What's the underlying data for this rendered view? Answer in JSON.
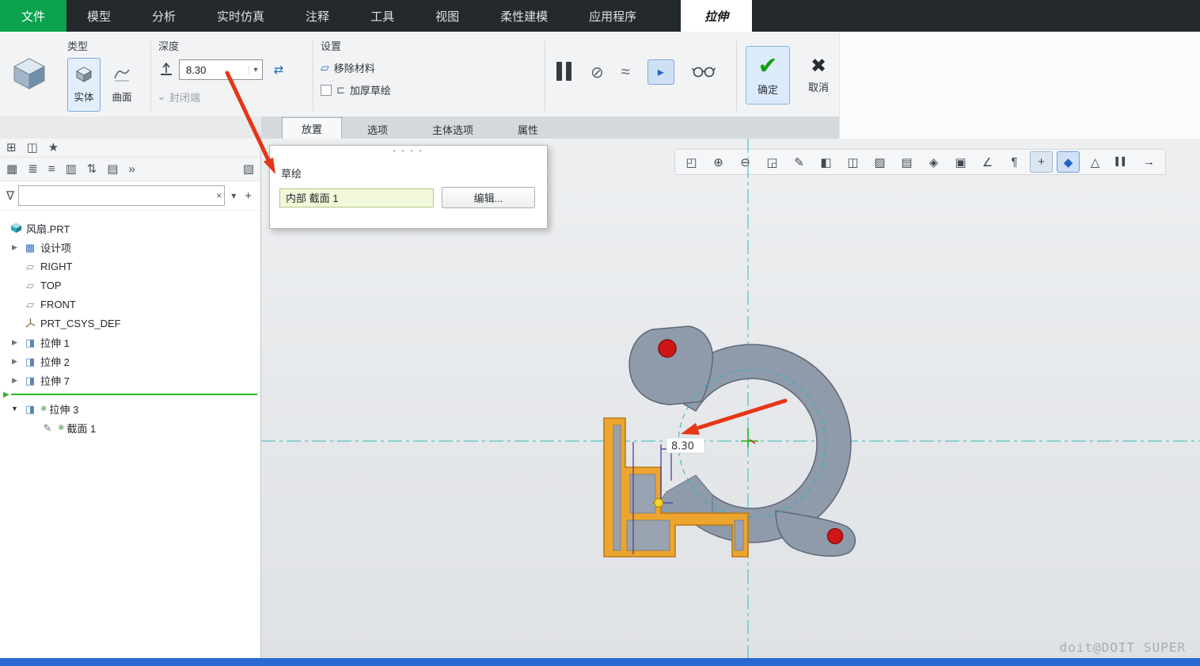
{
  "menubar": {
    "file_label": "文件",
    "items": [
      "模型",
      "分析",
      "实时仿真",
      "注释",
      "工具",
      "视图",
      "柔性建模",
      "应用程序"
    ],
    "feature_tab": "拉伸"
  },
  "ribbon": {
    "type_group": {
      "label": "类型",
      "solid_label": "实体",
      "surface_label": "曲面"
    },
    "depth_group": {
      "label": "深度",
      "depth_value": "8.30",
      "caret": "▾",
      "flip_glyph": "⇄",
      "capped_label": "封闭端",
      "capped_glyph": "◒"
    },
    "settings_group": {
      "label": "设置",
      "remove_material_label": "移除材料",
      "remove_material_glyph": "▱",
      "thicken_label": "加厚草绘",
      "thicken_glyph": "⊏"
    },
    "preview_group": {
      "no_preview_glyph": "⊘",
      "attached_glyph": "≈",
      "verify_glyph": "▸"
    },
    "confirm_group": {
      "ok_glyph": "✔",
      "ok_label": "确定",
      "cancel_glyph": "✖",
      "cancel_label": "取消"
    }
  },
  "dashboard_tabs": [
    {
      "label": "放置"
    },
    {
      "label": "选项"
    },
    {
      "label": "主体选项"
    },
    {
      "label": "属性"
    }
  ],
  "placement_panel": {
    "grip": "▪ ▪ ▪ ▪",
    "sketch_label": "草绘",
    "section_value": "内部 截面 1",
    "edit_label": "编辑..."
  },
  "tree_toolbar": {
    "row1": [
      {
        "name": "item-display",
        "glyph": "⊞"
      },
      {
        "name": "layer-tree",
        "glyph": "◫"
      },
      {
        "name": "favorites",
        "glyph": "★"
      }
    ],
    "row2": [
      {
        "name": "model-tree",
        "glyph": "▦"
      },
      {
        "name": "tree-filters",
        "glyph": "≣"
      },
      {
        "name": "tree-list",
        "glyph": "≡"
      },
      {
        "name": "column-display",
        "glyph": "▥"
      },
      {
        "name": "sort-order",
        "glyph": "⇅"
      },
      {
        "name": "settings-list",
        "glyph": "▤"
      },
      {
        "name": "overflow",
        "glyph": "»"
      },
      {
        "name": "tree-doc",
        "glyph": "▧"
      }
    ],
    "filter": {
      "funnel": "∇",
      "value": "",
      "clear": "×",
      "caret": "▾",
      "add": "+"
    }
  },
  "model_tree": {
    "root": {
      "label": "风扇.PRT"
    },
    "items": [
      {
        "arrow": "▶",
        "label": "设计项"
      },
      {
        "arrow": "",
        "label": "RIGHT"
      },
      {
        "arrow": "",
        "label": "TOP"
      },
      {
        "arrow": "",
        "label": "FRONT"
      },
      {
        "arrow": "",
        "label": "PRT_CSYS_DEF"
      },
      {
        "arrow": "▶",
        "label": "拉伸 1"
      },
      {
        "arrow": "▶",
        "label": "拉伸 2"
      },
      {
        "arrow": "▶",
        "label": "拉伸 7"
      },
      {
        "arrow": "▼",
        "label": "拉伸 3",
        "marker": "※"
      },
      {
        "arrow": "",
        "label": "截面 1",
        "marker": "※"
      }
    ]
  },
  "graphics_toolbar": [
    {
      "name": "zoom-region",
      "glyph": "◰"
    },
    {
      "name": "zoom-in",
      "glyph": "⊕"
    },
    {
      "name": "zoom-out",
      "glyph": "⊖"
    },
    {
      "name": "refit",
      "glyph": "◲"
    },
    {
      "name": "repaint",
      "glyph": "✎"
    },
    {
      "name": "display-style",
      "glyph": "◧"
    },
    {
      "name": "section-view",
      "glyph": "◫"
    },
    {
      "name": "appearance-gallery",
      "glyph": "▨"
    },
    {
      "name": "scene-render",
      "glyph": "▤"
    },
    {
      "name": "saved-orientations",
      "glyph": "◈"
    },
    {
      "name": "view-manager",
      "glyph": "▣"
    },
    {
      "name": "datum-display-filter",
      "glyph": "∠"
    },
    {
      "name": "annotation-display",
      "glyph": "¶"
    },
    {
      "name": "spin-center",
      "glyph": "+"
    },
    {
      "name": "3d-dragger",
      "glyph": "◆"
    },
    {
      "name": "warning",
      "glyph": "△"
    },
    {
      "name": "pause",
      "glyph": "▌▌"
    },
    {
      "name": "exit-tool",
      "glyph": "→"
    }
  ],
  "graphics": {
    "dimension_value": "8.30",
    "watermark": "doit@DOIT SUPER"
  },
  "colors": {
    "accent_blue": "#1f66c2",
    "file_green": "#0aa24e",
    "ok_green": "#13a013",
    "highlight_orange": "#eda52f",
    "model_gray": "#8f9aab",
    "crosshair_teal": "#35b6b8",
    "annotation_red": "#e63517",
    "statusbar_blue": "#2a68d4"
  }
}
